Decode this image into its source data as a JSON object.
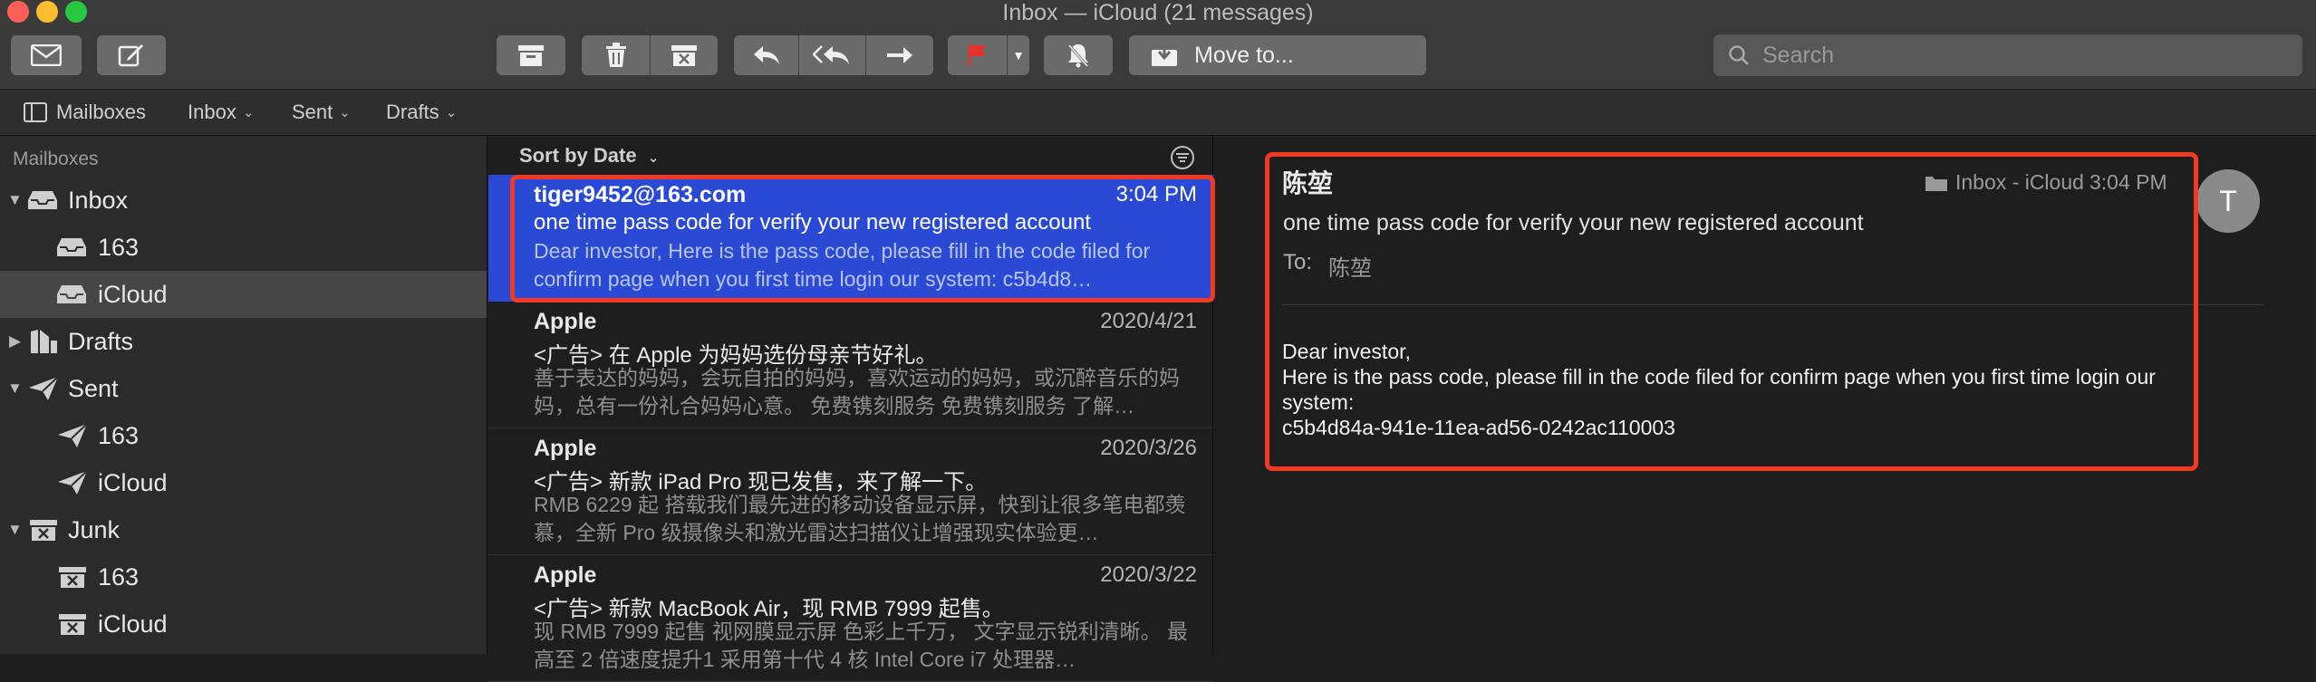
{
  "window": {
    "title": "Inbox — iCloud (21 messages)"
  },
  "toolbar": {
    "move_to_label": "Move to...",
    "search_placeholder": "Search",
    "icons": [
      "get-mail-icon",
      "compose-icon",
      "archive-icon",
      "trash-icon",
      "junk-icon",
      "reply-icon",
      "reply-all-icon",
      "forward-icon",
      "flag-icon",
      "mute-icon",
      "move-icon",
      "search-icon"
    ],
    "flag_color": "#e5322a"
  },
  "favorites": {
    "mailboxes_label": "Mailboxes",
    "inbox_label": "Inbox",
    "sent_label": "Sent",
    "drafts_label": "Drafts"
  },
  "sidebar": {
    "header": "Mailboxes",
    "items": [
      {
        "label": "Inbox",
        "icon": "inbox-icon",
        "level": 0,
        "expanded": true
      },
      {
        "label": "163",
        "icon": "inbox-icon",
        "level": 1
      },
      {
        "label": "iCloud",
        "icon": "inbox-icon",
        "level": 1,
        "selected": true
      },
      {
        "label": "Drafts",
        "icon": "drafts-icon",
        "level": 0,
        "expanded": false
      },
      {
        "label": "Sent",
        "icon": "sent-icon",
        "level": 0,
        "expanded": true
      },
      {
        "label": "163",
        "icon": "sent-icon",
        "level": 1
      },
      {
        "label": "iCloud",
        "icon": "sent-icon",
        "level": 1
      },
      {
        "label": "Junk",
        "icon": "junk-icon",
        "level": 0,
        "expanded": true
      },
      {
        "label": "163",
        "icon": "junk-icon",
        "level": 1
      },
      {
        "label": "iCloud",
        "icon": "junk-icon",
        "level": 1
      }
    ]
  },
  "message_list": {
    "sort_label": "Sort by Date",
    "messages": [
      {
        "from": "tiger9452@163.com",
        "date": "3:04 PM",
        "subject": "one time pass code for verify your new registered account",
        "preview": "Dear investor, Here is the pass code, please fill in the code filed for confirm page when you first time login our system: c5b4d8…",
        "selected": true
      },
      {
        "from": "Apple",
        "date": "2020/4/21",
        "subject": "<广告> 在 Apple 为妈妈选份母亲节好礼。",
        "preview": "善于表达的妈妈，会玩自拍的妈妈，喜欢运动的妈妈，或沉醉音乐的妈妈，总有一份礼合妈妈心意。 免费镌刻服务 免费镌刻服务 了解…"
      },
      {
        "from": "Apple",
        "date": "2020/3/26",
        "subject": "<广告> 新款 iPad Pro 现已发售，来了解一下。",
        "preview": "RMB 6229 起 搭载我们最先进的移动设备显示屏，快到让很多笔电都羡慕，全新 Pro 级摄像头和激光雷达扫描仪让增强现实体验更…"
      },
      {
        "from": "Apple",
        "date": "2020/3/22",
        "subject": "<广告> 新款 MacBook Air，现 RMB 7999 起售。",
        "preview": "现 RMB 7999 起售 视网膜显示屏 色彩上千万， 文字显示锐利清晰。 最高至 2 倍速度提升1 采用第十代 4 核 Intel Core i7 处理器…"
      }
    ]
  },
  "reader": {
    "from": "陈堃",
    "mailbox": "Inbox - iCloud",
    "time": "3:04 PM",
    "subject": "one time pass code for verify your new registered account",
    "to_label": "To:",
    "to": "陈堃",
    "body_lines": [
      "Dear investor,",
      "Here is the pass code, please fill in the code filed for confirm page when you first time login our system:",
      "c5b4d84a-941e-11ea-ad56-0242ac110003"
    ],
    "avatar_letter": "T"
  },
  "colors": {
    "accent": "#2a4ad6",
    "highlight": "#f03a24"
  }
}
